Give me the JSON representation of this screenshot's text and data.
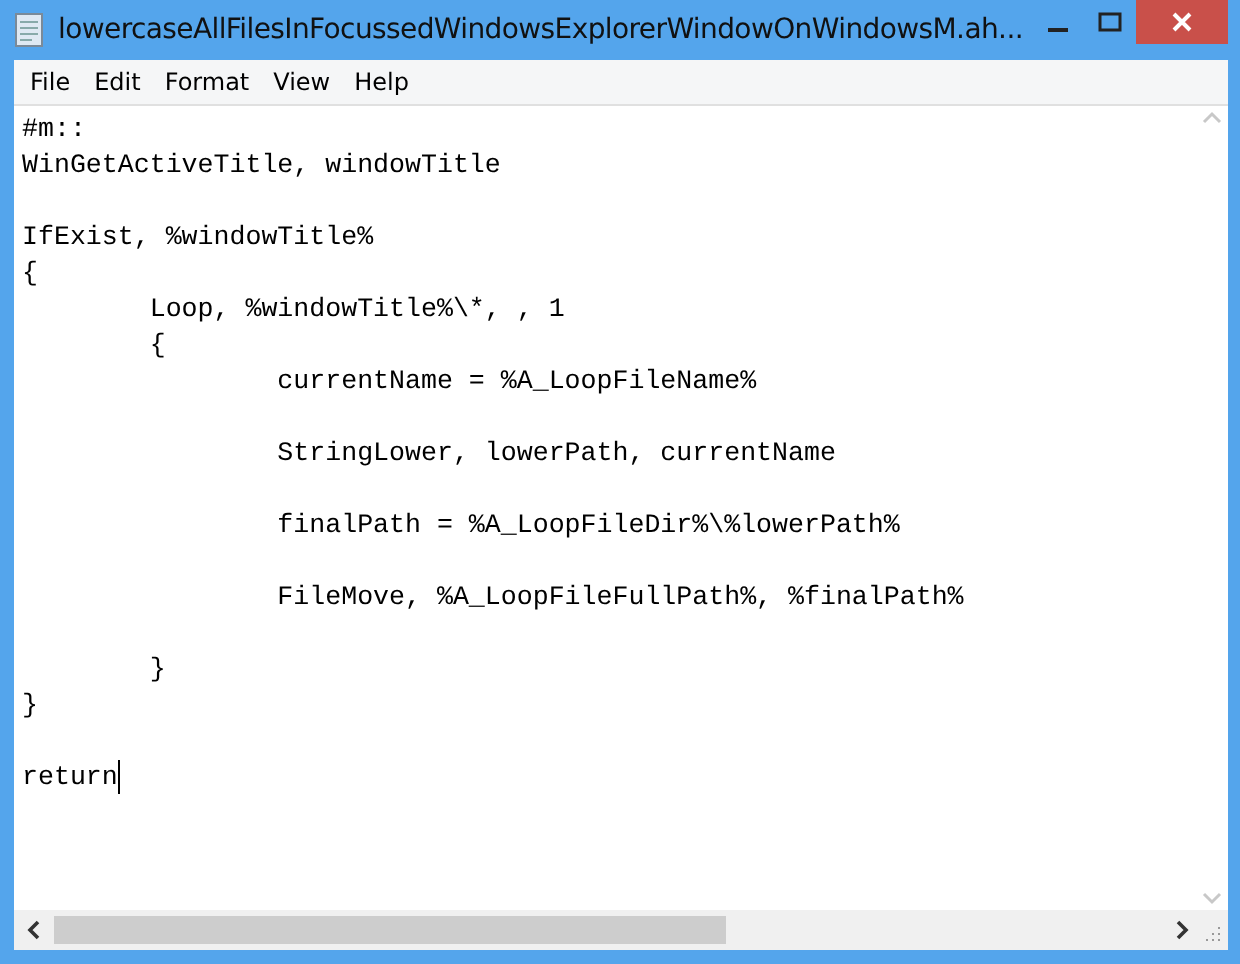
{
  "window": {
    "title": "lowercaseAllFilesInFocussedWindowsExplorerWindowOnWindowsM.ah..."
  },
  "menu": [
    {
      "label": "File"
    },
    {
      "label": "Edit"
    },
    {
      "label": "Format"
    },
    {
      "label": "View"
    },
    {
      "label": "Help"
    }
  ],
  "editor": {
    "text": "#m::\nWinGetActiveTitle, windowTitle\n\nIfExist, %windowTitle%\n{\n\tLoop, %windowTitle%\\*, , 1\n\t{\n\t\tcurrentName = %A_LoopFileName%\n\n\t\tStringLower, lowerPath, currentName\n\n\t\tfinalPath = %A_LoopFileDir%\\%lowerPath%\n\n\t\tFileMove, %A_LoopFileFullPath%, %finalPath%\n\n\t}\n}\n\nreturn"
  }
}
